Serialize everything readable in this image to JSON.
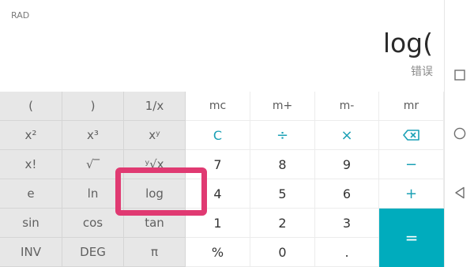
{
  "display": {
    "angle_mode": "RAD",
    "expression": "log(",
    "result": "错误"
  },
  "keypad": {
    "sci": {
      "open_paren": "(",
      "close_paren": ")",
      "reciprocal": "1/x",
      "square": "x²",
      "cube": "x³",
      "power": "xʸ",
      "factorial": "x!",
      "sqrt": "√‾",
      "yroot": "ʸ√x",
      "e": "e",
      "ln": "ln",
      "log": "log",
      "sin": "sin",
      "cos": "cos",
      "tan": "tan",
      "inv": "INV",
      "deg": "DEG",
      "pi": "π"
    },
    "memory": {
      "mc": "mc",
      "mplus": "m+",
      "mminus": "m-",
      "mr": "mr"
    },
    "ops": {
      "clear": "C",
      "divide": "÷",
      "multiply": "×",
      "backspace_icon": "backspace-icon",
      "minus": "−",
      "plus": "+",
      "equals": "="
    },
    "digits": {
      "d7": "7",
      "d8": "8",
      "d9": "9",
      "d4": "4",
      "d5": "5",
      "d6": "6",
      "d1": "1",
      "d2": "2",
      "d3": "3",
      "percent": "%",
      "d0": "0",
      "dot": "."
    }
  },
  "navbar": {
    "icons": [
      "square-icon",
      "circle-icon",
      "back-triangle-icon"
    ]
  },
  "colors": {
    "accent": "#1aa0b5",
    "equals_bg": "#00acbd",
    "highlight": "#e03a72",
    "sci_bg": "#e7e7e7"
  }
}
